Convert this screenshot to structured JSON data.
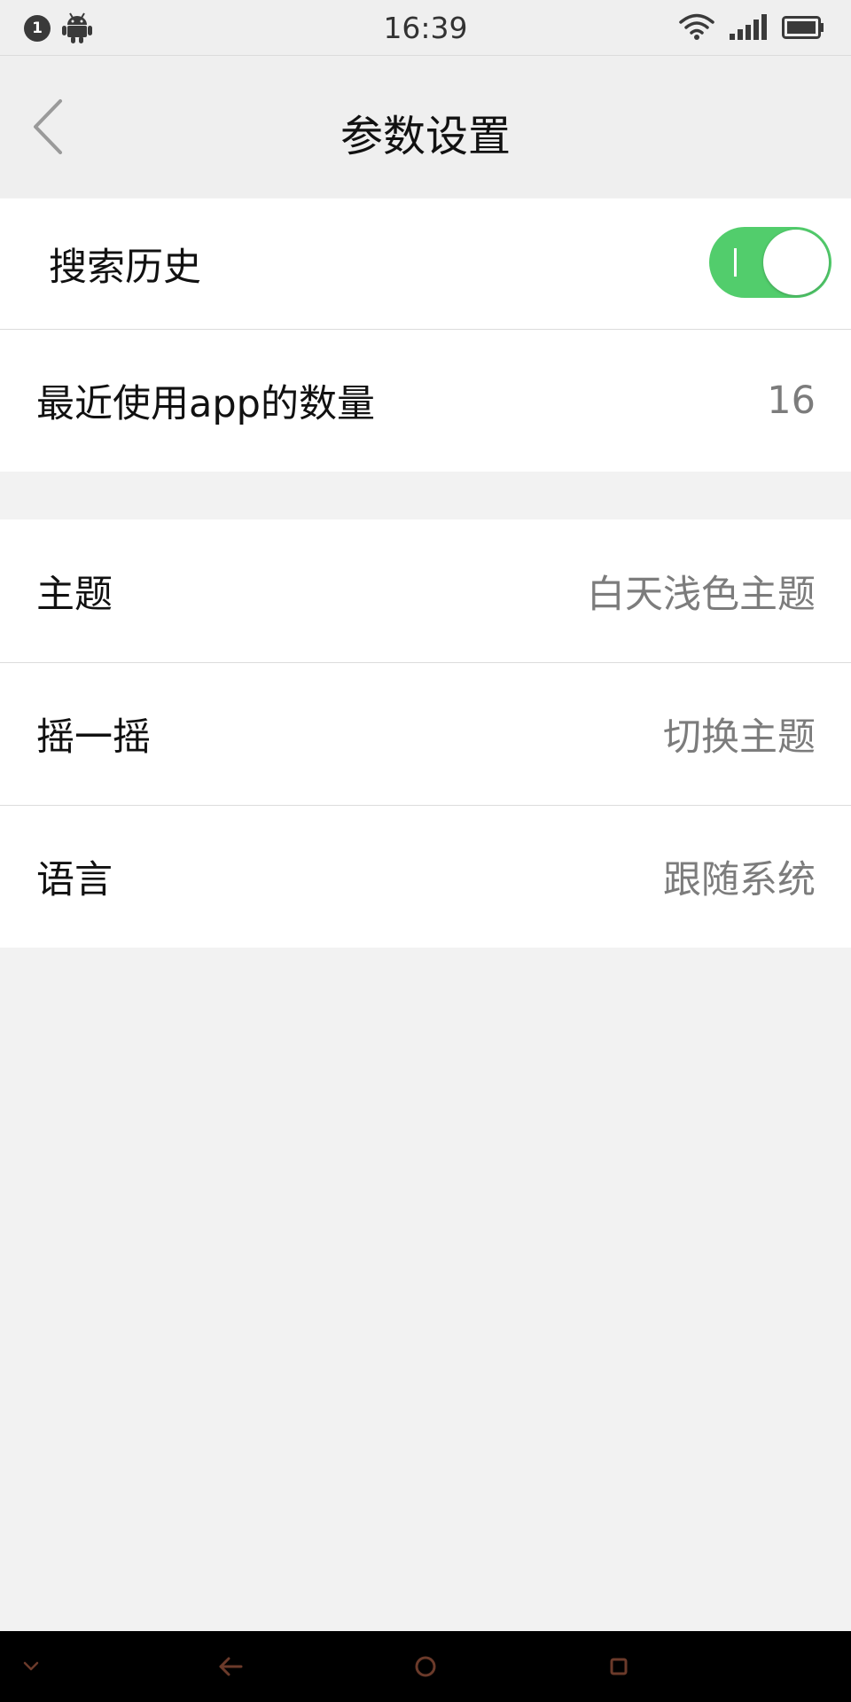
{
  "status_bar": {
    "notification_count": "1",
    "time": "16:39",
    "icons": [
      "android-icon",
      "wifi-icon",
      "signal-icon",
      "battery-icon"
    ]
  },
  "header": {
    "title": "参数设置",
    "back_icon": "chevron-left-icon"
  },
  "settings": {
    "search_history": {
      "label": "搜索历史",
      "enabled": true
    },
    "recent_apps": {
      "label": "最近使用app的数量",
      "value": "16"
    },
    "theme": {
      "label": "主题",
      "value": "白天浅色主题"
    },
    "shake": {
      "label": "摇一摇",
      "value": "切换主题"
    },
    "language": {
      "label": "语言",
      "value": "跟随系统"
    }
  },
  "nav_bar": {
    "icons": [
      "chevron-down-icon",
      "back-arrow-icon",
      "home-circle-icon",
      "recents-square-icon"
    ]
  },
  "colors": {
    "toggle_on": "#52cd6c",
    "background": "#f2f2f2",
    "card": "#ffffff",
    "value_text": "#7c7c7c",
    "nav_icon": "#6b3a2a"
  }
}
